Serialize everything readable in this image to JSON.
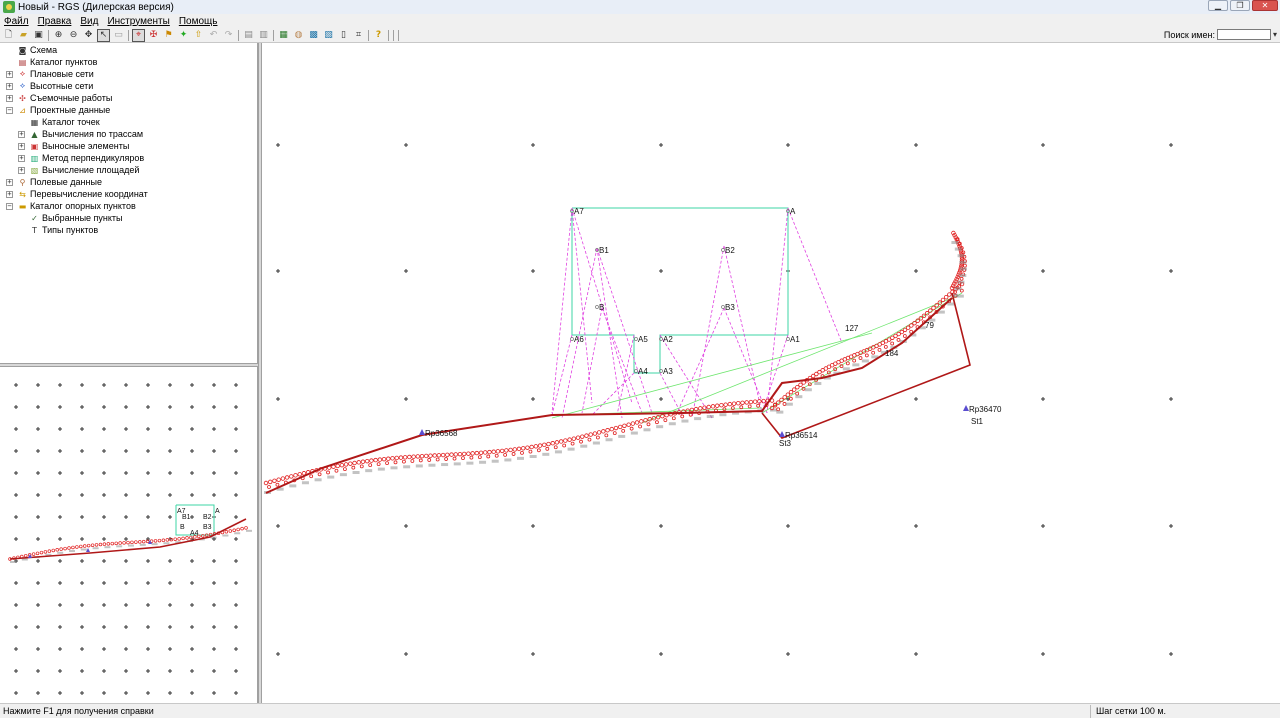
{
  "window": {
    "title": "Новый - RGS (Дилерская версия)",
    "controls": [
      "minimize-icon",
      "maximize-icon",
      "close-icon"
    ]
  },
  "menu": [
    "Файл",
    "Правка",
    "Вид",
    "Инструменты",
    "Помощь"
  ],
  "toolbar": {
    "buttons": [
      "new-file-icon",
      "open-folder-icon",
      "save-icon",
      "zoom-in-icon",
      "zoom-out-icon",
      "pan-icon",
      "select-arrow-icon",
      "erase-icon",
      "measure-icon",
      "traverse-icon",
      "level-icon",
      "survey-icon",
      "export-icon",
      "undo-icon",
      "redo-icon",
      "calc-icon",
      "report-icon",
      "table-icon",
      "globe-icon",
      "grid-icon",
      "list-icon",
      "doc-icon",
      "coords-icon",
      "help-icon"
    ],
    "search_label": "Поиск имен:",
    "search_value": ""
  },
  "tree": [
    {
      "label": "Схема",
      "level": 0,
      "expander": "",
      "icon": "binoculars-icon"
    },
    {
      "label": "Каталог пунктов",
      "level": 0,
      "expander": "",
      "icon": "catalog-icon"
    },
    {
      "label": "Плановые сети",
      "level": 0,
      "expander": "+",
      "icon": "plan-network-icon"
    },
    {
      "label": "Высотные сети",
      "level": 0,
      "expander": "+",
      "icon": "height-network-icon"
    },
    {
      "label": "Съемочные работы",
      "level": 0,
      "expander": "+",
      "icon": "survey-icon"
    },
    {
      "label": "Проектные данные",
      "level": 0,
      "expander": "−",
      "icon": "project-icon"
    },
    {
      "label": "Каталог точек",
      "level": 1,
      "expander": "",
      "icon": "points-catalog-icon"
    },
    {
      "label": "Вычисления по трассам",
      "level": 1,
      "expander": "+",
      "icon": "route-calc-icon"
    },
    {
      "label": "Выносные элементы",
      "level": 1,
      "expander": "+",
      "icon": "stakeout-icon"
    },
    {
      "label": "Метод перпендикуляров",
      "level": 1,
      "expander": "+",
      "icon": "perpendicular-icon"
    },
    {
      "label": "Вычисление площадей",
      "level": 1,
      "expander": "+",
      "icon": "area-calc-icon"
    },
    {
      "label": "Полевые данные",
      "level": 0,
      "expander": "+",
      "icon": "field-data-icon"
    },
    {
      "label": "Перевычисление координат",
      "level": 0,
      "expander": "+",
      "icon": "recalc-icon"
    },
    {
      "label": "Каталог опорных пунктов",
      "level": 0,
      "expander": "−",
      "icon": "control-catalog-icon"
    },
    {
      "label": "Выбранные пункты",
      "level": 1,
      "expander": "",
      "icon": "selected-points-icon"
    },
    {
      "label": "Типы пунктов",
      "level": 1,
      "expander": "",
      "icon": "point-types-icon"
    }
  ],
  "map": {
    "polygon_labels": [
      "A7",
      "A",
      "A6",
      "A5",
      "A2",
      "A1",
      "A4",
      "A3",
      "B1",
      "B2",
      "B",
      "B3"
    ],
    "station_labels": [
      "Rp36568",
      "Rp36514",
      "Rp36470",
      "St1",
      "St3",
      "127",
      "79",
      "184"
    ],
    "colors": {
      "points": "#e02020",
      "traverse": "#b01818",
      "project": "#3ed6a6",
      "dashed": "#e040e0",
      "lightgreen": "#6ee66e",
      "grid": "#333333"
    }
  },
  "overview": {
    "labels": [
      "A7",
      "A",
      "B1",
      "B2",
      "B",
      "B3",
      "A4"
    ]
  },
  "status": {
    "hint": "Нажмите F1 для получения справки",
    "grid_step": "Шаг сетки  100 м."
  }
}
